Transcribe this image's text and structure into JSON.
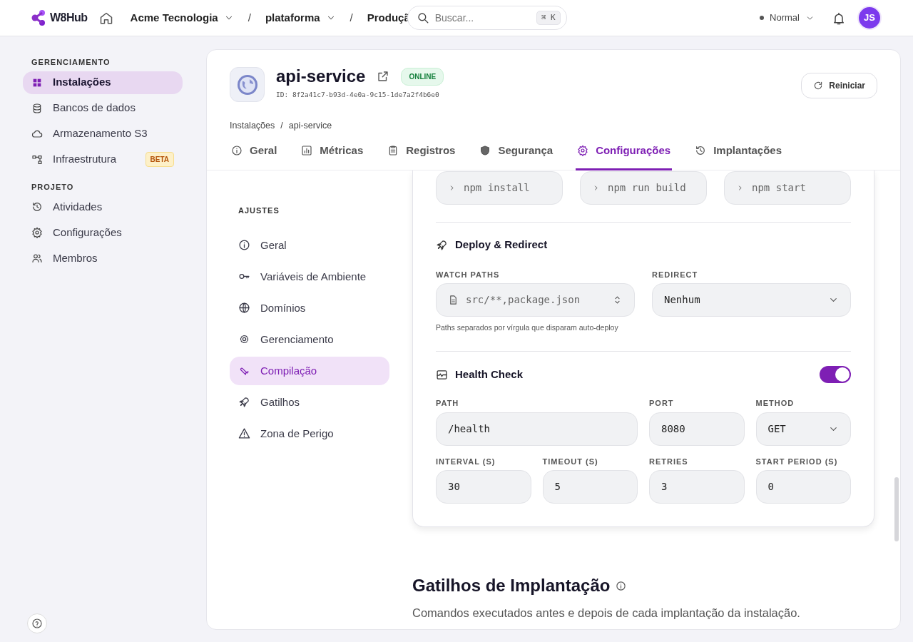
{
  "topbar": {
    "logo": "W8Hub",
    "separator": "/",
    "breadcrumbs": [
      {
        "label": "Acme Tecnologia",
        "dropdown": true
      },
      {
        "label": "plataforma",
        "dropdown": true
      },
      {
        "label": "Produçã",
        "dropdown": false
      }
    ],
    "search": {
      "placeholder": "Buscar...",
      "shortcut": "⌘ K"
    },
    "mode": {
      "label": "Normal"
    },
    "avatar": {
      "initials": "JS"
    }
  },
  "sidebar": {
    "sections": [
      {
        "title": "GERENCIAMENTO",
        "items": [
          {
            "label": "Instalações",
            "selected": true
          },
          {
            "label": "Bancos de dados",
            "selected": false
          },
          {
            "label": "Armazenamento S3",
            "selected": false
          },
          {
            "label": "Infraestrutura",
            "selected": false,
            "badge": "BETA"
          }
        ]
      },
      {
        "title": "PROJETO",
        "items": [
          {
            "label": "Atividades",
            "selected": false
          },
          {
            "label": "Configurações",
            "selected": false
          },
          {
            "label": "Membros",
            "selected": false
          }
        ]
      }
    ]
  },
  "header": {
    "title": "api-service",
    "status": "ONLINE",
    "id": "ID: 8f2a41c7-b93d-4e0a-9c15-1de7a2f4b6e0",
    "restart_button": "Reiniciar",
    "breadcrumb": [
      "Instalações",
      "api-service"
    ],
    "breadcrumb_separator": "/",
    "tabs": [
      {
        "label": "Geral",
        "selected": false
      },
      {
        "label": "Métricas",
        "selected": false
      },
      {
        "label": "Registros",
        "selected": false
      },
      {
        "label": "Segurança",
        "selected": false
      },
      {
        "label": "Configurações",
        "selected": true
      },
      {
        "label": "Implantações",
        "selected": false
      }
    ]
  },
  "settings_nav": {
    "title": "AJUSTES",
    "items": [
      {
        "label": "Geral",
        "selected": false
      },
      {
        "label": "Variáveis de Ambiente",
        "selected": false
      },
      {
        "label": "Domínios",
        "selected": false
      },
      {
        "label": "Gerenciamento",
        "selected": false
      },
      {
        "label": "Compilação",
        "selected": true
      },
      {
        "label": "Gatilhos",
        "selected": false
      },
      {
        "label": "Zona de Perigo",
        "selected": false
      }
    ]
  },
  "build_commands": [
    {
      "placeholder": "npm install"
    },
    {
      "placeholder": "npm run build"
    },
    {
      "placeholder": "npm start"
    }
  ],
  "deploy": {
    "title": "Deploy & Redirect",
    "watch_paths": {
      "label": "WATCH PATHS",
      "placeholder": "src/**,package.json",
      "hint": "Paths separados por vírgula que disparam auto-deploy"
    },
    "redirect": {
      "label": "REDIRECT",
      "value": "Nenhum"
    }
  },
  "health_check": {
    "title": "Health Check",
    "on": true,
    "fields": [
      {
        "label": "PATH",
        "value": "/health",
        "kind": "wide"
      },
      {
        "label": "PORT",
        "value": "8080",
        "kind": "text"
      },
      {
        "label": "METHOD",
        "value": "GET",
        "kind": "select"
      },
      {
        "label": "INTERVAL (S)",
        "value": "30",
        "kind": "text"
      },
      {
        "label": "TIMEOUT (S)",
        "value": "5",
        "kind": "text"
      },
      {
        "label": "RETRIES",
        "value": "3",
        "kind": "text"
      },
      {
        "label": "START PERIOD (S)",
        "value": "0",
        "kind": "text"
      }
    ]
  },
  "triggers": {
    "title": "Gatilhos de Implantação",
    "description": "Comandos executados antes e depois de cada implantação da instalação."
  }
}
